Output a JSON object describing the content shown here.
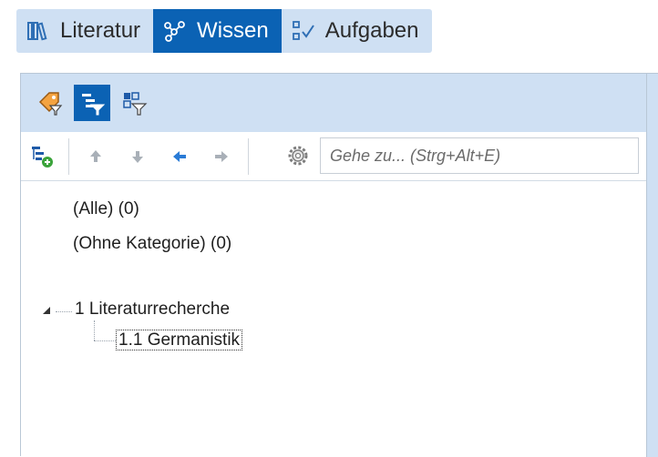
{
  "tabs": [
    {
      "label": "Literatur",
      "icon": "library-icon",
      "active": false
    },
    {
      "label": "Wissen",
      "icon": "knowledge-graph-icon",
      "active": true
    },
    {
      "label": "Aufgaben",
      "icon": "tasks-checklist-icon",
      "active": false
    }
  ],
  "toolbar_top": {
    "buttons": [
      {
        "icon": "tag-filter-icon",
        "active": false
      },
      {
        "icon": "category-filter-icon",
        "active": true
      },
      {
        "icon": "grid-filter-icon",
        "active": false
      }
    ]
  },
  "toolbar_nav": {
    "add_category_icon": "add-category-icon",
    "arrows": [
      "arrow-up-icon",
      "arrow-down-icon",
      "arrow-left-icon",
      "arrow-right-icon"
    ],
    "settings_icon": "gear-icon",
    "search_placeholder": "Gehe zu... (Strg+Alt+E)"
  },
  "tree": {
    "all": "(Alle) (0)",
    "uncategorized": "(Ohne Kategorie) (0)",
    "category": "1 Literaturrecherche",
    "subcategory": "1.1 Germanistik"
  },
  "colors": {
    "accent": "#0b62b4",
    "toolbar_bg": "#cfe0f3"
  }
}
